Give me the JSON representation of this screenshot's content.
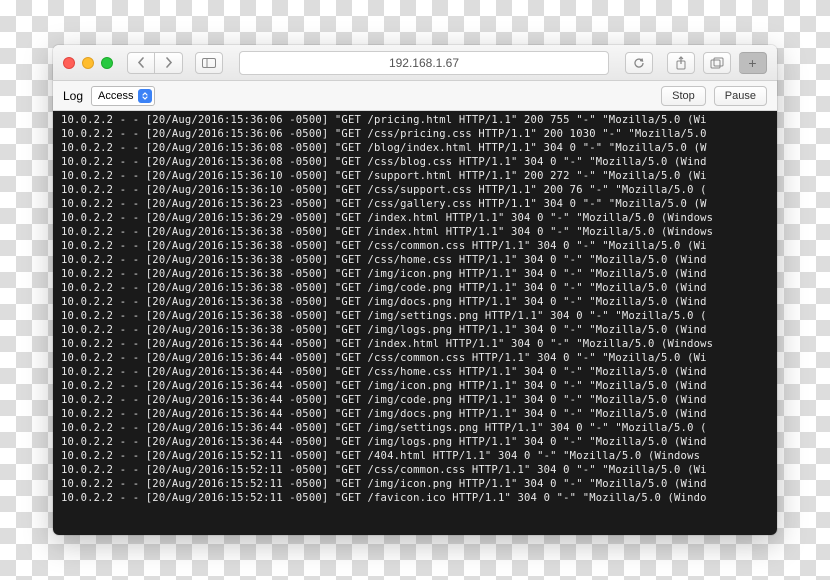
{
  "titlebar": {
    "address": "192.168.1.67"
  },
  "toolbar": {
    "label_log": "Log",
    "select_value": "Access",
    "stop_label": "Stop",
    "pause_label": "Pause"
  },
  "log": {
    "entries": [
      {
        "ip": "10.0.2.2",
        "ts": "20/Aug/2016:15:36:06 -0500",
        "mth": "GET",
        "path": "/pricing.html",
        "proto": "HTTP/1.1",
        "status": 200,
        "size": 755,
        "ref": "-",
        "ua": "Mozilla/5.0 (Wi"
      },
      {
        "ip": "10.0.2.2",
        "ts": "20/Aug/2016:15:36:06 -0500",
        "mth": "GET",
        "path": "/css/pricing.css",
        "proto": "HTTP/1.1",
        "status": 200,
        "size": 1030,
        "ref": "-",
        "ua": "Mozilla/5.0"
      },
      {
        "ip": "10.0.2.2",
        "ts": "20/Aug/2016:15:36:08 -0500",
        "mth": "GET",
        "path": "/blog/index.html",
        "proto": "HTTP/1.1",
        "status": 304,
        "size": 0,
        "ref": "-",
        "ua": "Mozilla/5.0 (W"
      },
      {
        "ip": "10.0.2.2",
        "ts": "20/Aug/2016:15:36:08 -0500",
        "mth": "GET",
        "path": "/css/blog.css",
        "proto": "HTTP/1.1",
        "status": 304,
        "size": 0,
        "ref": "-",
        "ua": "Mozilla/5.0 (Wind"
      },
      {
        "ip": "10.0.2.2",
        "ts": "20/Aug/2016:15:36:10 -0500",
        "mth": "GET",
        "path": "/support.html",
        "proto": "HTTP/1.1",
        "status": 200,
        "size": 272,
        "ref": "-",
        "ua": "Mozilla/5.0 (Wi"
      },
      {
        "ip": "10.0.2.2",
        "ts": "20/Aug/2016:15:36:10 -0500",
        "mth": "GET",
        "path": "/css/support.css",
        "proto": "HTTP/1.1",
        "status": 200,
        "size": 76,
        "ref": "-",
        "ua": "Mozilla/5.0 ("
      },
      {
        "ip": "10.0.2.2",
        "ts": "20/Aug/2016:15:36:23 -0500",
        "mth": "GET",
        "path": "/css/gallery.css",
        "proto": "HTTP/1.1",
        "status": 304,
        "size": 0,
        "ref": "-",
        "ua": "Mozilla/5.0 (W"
      },
      {
        "ip": "10.0.2.2",
        "ts": "20/Aug/2016:15:36:29 -0500",
        "mth": "GET",
        "path": "/index.html",
        "proto": "HTTP/1.1",
        "status": 304,
        "size": 0,
        "ref": "-",
        "ua": "Mozilla/5.0 (Windows"
      },
      {
        "ip": "10.0.2.2",
        "ts": "20/Aug/2016:15:36:38 -0500",
        "mth": "GET",
        "path": "/index.html",
        "proto": "HTTP/1.1",
        "status": 304,
        "size": 0,
        "ref": "-",
        "ua": "Mozilla/5.0 (Windows"
      },
      {
        "ip": "10.0.2.2",
        "ts": "20/Aug/2016:15:36:38 -0500",
        "mth": "GET",
        "path": "/css/common.css",
        "proto": "HTTP/1.1",
        "status": 304,
        "size": 0,
        "ref": "-",
        "ua": "Mozilla/5.0 (Wi"
      },
      {
        "ip": "10.0.2.2",
        "ts": "20/Aug/2016:15:36:38 -0500",
        "mth": "GET",
        "path": "/css/home.css",
        "proto": "HTTP/1.1",
        "status": 304,
        "size": 0,
        "ref": "-",
        "ua": "Mozilla/5.0 (Wind"
      },
      {
        "ip": "10.0.2.2",
        "ts": "20/Aug/2016:15:36:38 -0500",
        "mth": "GET",
        "path": "/img/icon.png",
        "proto": "HTTP/1.1",
        "status": 304,
        "size": 0,
        "ref": "-",
        "ua": "Mozilla/5.0 (Wind"
      },
      {
        "ip": "10.0.2.2",
        "ts": "20/Aug/2016:15:36:38 -0500",
        "mth": "GET",
        "path": "/img/code.png",
        "proto": "HTTP/1.1",
        "status": 304,
        "size": 0,
        "ref": "-",
        "ua": "Mozilla/5.0 (Wind"
      },
      {
        "ip": "10.0.2.2",
        "ts": "20/Aug/2016:15:36:38 -0500",
        "mth": "GET",
        "path": "/img/docs.png",
        "proto": "HTTP/1.1",
        "status": 304,
        "size": 0,
        "ref": "-",
        "ua": "Mozilla/5.0 (Wind"
      },
      {
        "ip": "10.0.2.2",
        "ts": "20/Aug/2016:15:36:38 -0500",
        "mth": "GET",
        "path": "/img/settings.png",
        "proto": "HTTP/1.1",
        "status": 304,
        "size": 0,
        "ref": "-",
        "ua": "Mozilla/5.0 ("
      },
      {
        "ip": "10.0.2.2",
        "ts": "20/Aug/2016:15:36:38 -0500",
        "mth": "GET",
        "path": "/img/logs.png",
        "proto": "HTTP/1.1",
        "status": 304,
        "size": 0,
        "ref": "-",
        "ua": "Mozilla/5.0 (Wind"
      },
      {
        "ip": "10.0.2.2",
        "ts": "20/Aug/2016:15:36:44 -0500",
        "mth": "GET",
        "path": "/index.html",
        "proto": "HTTP/1.1",
        "status": 304,
        "size": 0,
        "ref": "-",
        "ua": "Mozilla/5.0 (Windows"
      },
      {
        "ip": "10.0.2.2",
        "ts": "20/Aug/2016:15:36:44 -0500",
        "mth": "GET",
        "path": "/css/common.css",
        "proto": "HTTP/1.1",
        "status": 304,
        "size": 0,
        "ref": "-",
        "ua": "Mozilla/5.0 (Wi"
      },
      {
        "ip": "10.0.2.2",
        "ts": "20/Aug/2016:15:36:44 -0500",
        "mth": "GET",
        "path": "/css/home.css",
        "proto": "HTTP/1.1",
        "status": 304,
        "size": 0,
        "ref": "-",
        "ua": "Mozilla/5.0 (Wind"
      },
      {
        "ip": "10.0.2.2",
        "ts": "20/Aug/2016:15:36:44 -0500",
        "mth": "GET",
        "path": "/img/icon.png",
        "proto": "HTTP/1.1",
        "status": 304,
        "size": 0,
        "ref": "-",
        "ua": "Mozilla/5.0 (Wind"
      },
      {
        "ip": "10.0.2.2",
        "ts": "20/Aug/2016:15:36:44 -0500",
        "mth": "GET",
        "path": "/img/code.png",
        "proto": "HTTP/1.1",
        "status": 304,
        "size": 0,
        "ref": "-",
        "ua": "Mozilla/5.0 (Wind"
      },
      {
        "ip": "10.0.2.2",
        "ts": "20/Aug/2016:15:36:44 -0500",
        "mth": "GET",
        "path": "/img/docs.png",
        "proto": "HTTP/1.1",
        "status": 304,
        "size": 0,
        "ref": "-",
        "ua": "Mozilla/5.0 (Wind"
      },
      {
        "ip": "10.0.2.2",
        "ts": "20/Aug/2016:15:36:44 -0500",
        "mth": "GET",
        "path": "/img/settings.png",
        "proto": "HTTP/1.1",
        "status": 304,
        "size": 0,
        "ref": "-",
        "ua": "Mozilla/5.0 ("
      },
      {
        "ip": "10.0.2.2",
        "ts": "20/Aug/2016:15:36:44 -0500",
        "mth": "GET",
        "path": "/img/logs.png",
        "proto": "HTTP/1.1",
        "status": 304,
        "size": 0,
        "ref": "-",
        "ua": "Mozilla/5.0 (Wind"
      },
      {
        "ip": "10.0.2.2",
        "ts": "20/Aug/2016:15:52:11 -0500",
        "mth": "GET",
        "path": "/404.html",
        "proto": "HTTP/1.1",
        "status": 304,
        "size": 0,
        "ref": "-",
        "ua": "Mozilla/5.0 (Windows "
      },
      {
        "ip": "10.0.2.2",
        "ts": "20/Aug/2016:15:52:11 -0500",
        "mth": "GET",
        "path": "/css/common.css",
        "proto": "HTTP/1.1",
        "status": 304,
        "size": 0,
        "ref": "-",
        "ua": "Mozilla/5.0 (Wi"
      },
      {
        "ip": "10.0.2.2",
        "ts": "20/Aug/2016:15:52:11 -0500",
        "mth": "GET",
        "path": "/img/icon.png",
        "proto": "HTTP/1.1",
        "status": 304,
        "size": 0,
        "ref": "-",
        "ua": "Mozilla/5.0 (Wind"
      },
      {
        "ip": "10.0.2.2",
        "ts": "20/Aug/2016:15:52:11 -0500",
        "mth": "GET",
        "path": "/favicon.ico",
        "proto": "HTTP/1.1",
        "status": 304,
        "size": 0,
        "ref": "-",
        "ua": "Mozilla/5.0 (Windo"
      }
    ]
  }
}
